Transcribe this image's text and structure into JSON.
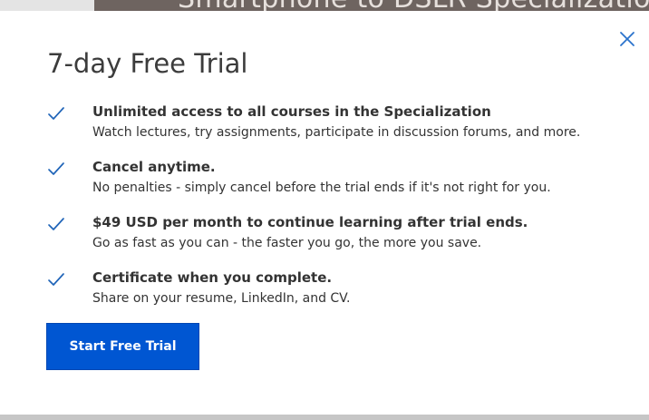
{
  "background": {
    "hero_title": "Smartphone to DSLR Specialization"
  },
  "modal": {
    "title": "7-day Free Trial",
    "close_icon": "close-icon",
    "check_icon": "checkmark-icon",
    "features": [
      {
        "title": "Unlimited access to all courses in the Specialization",
        "description": "Watch lectures, try assignments, participate in discussion forums, and more."
      },
      {
        "title": "Cancel anytime.",
        "description": "No penalties - simply cancel before the trial ends if it's not right for you."
      },
      {
        "title": "$49 USD per month to continue learning after trial ends.",
        "description": "Go as fast as you can - the faster you go, the more you save."
      },
      {
        "title": "Certificate when you complete.",
        "description": "Share on your resume, LinkedIn, and CV."
      }
    ],
    "cta_label": "Start Free Trial"
  },
  "colors": {
    "accent": "#0056d2",
    "check": "#1f64b8",
    "text": "#333333",
    "title": "#3c3c3c"
  }
}
